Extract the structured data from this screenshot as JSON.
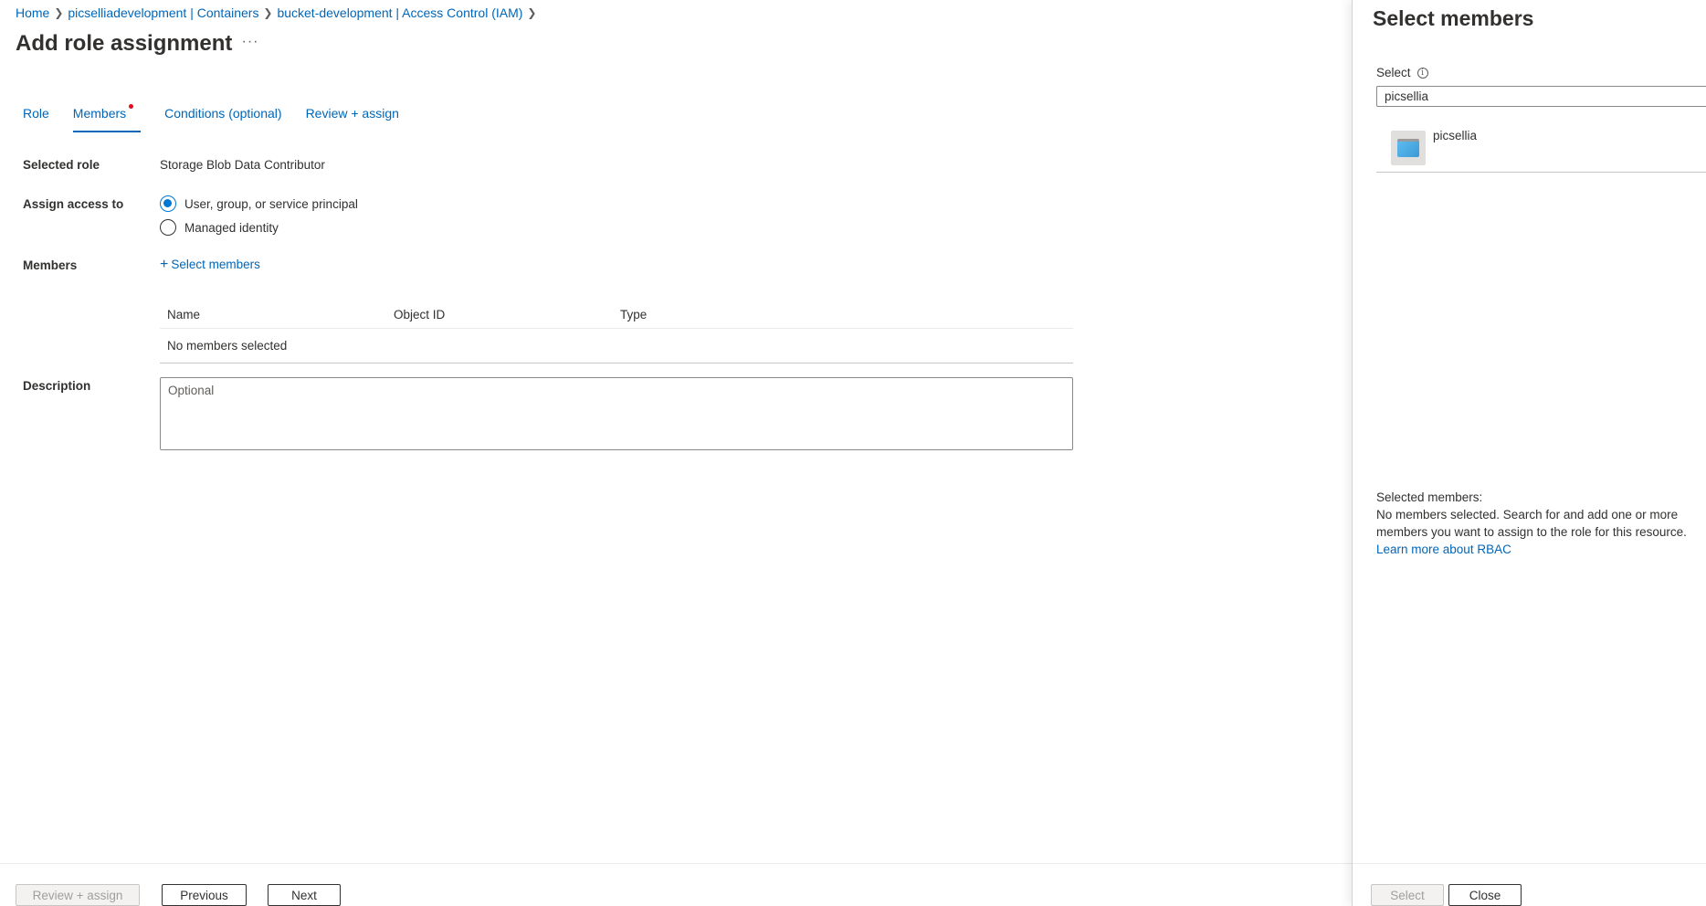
{
  "breadcrumb": {
    "items": [
      "Home",
      "picselliadevelopment | Containers",
      "bucket-development | Access Control (IAM)"
    ]
  },
  "page": {
    "title": "Add role assignment",
    "more": "···"
  },
  "tabs": [
    {
      "label": "Role"
    },
    {
      "label": "Members"
    },
    {
      "label": "Conditions (optional)"
    },
    {
      "label": "Review + assign"
    }
  ],
  "form": {
    "selected_role_label": "Selected role",
    "selected_role_value": "Storage Blob Data Contributor",
    "assign_access_label": "Assign access to",
    "assign_options": [
      "User, group, or service principal",
      "Managed identity"
    ],
    "members_label": "Members",
    "select_members_link": "Select members",
    "table_headers": [
      "Name",
      "Object ID",
      "Type"
    ],
    "table_empty": "No members selected",
    "description_label": "Description",
    "description_placeholder": "Optional"
  },
  "footer": {
    "review_assign": "Review + assign",
    "previous": "Previous",
    "next": "Next"
  },
  "panel": {
    "title": "Select members",
    "select_label": "Select",
    "search_value": "picsellia",
    "results": [
      {
        "name": "picsellia"
      }
    ],
    "selected_members_title": "Selected members:",
    "selected_members_desc": "No members selected. Search for and add one or more members you want to assign to the role for this resource.",
    "learn_more": "Learn more about RBAC",
    "select_button": "Select",
    "close_button": "Close"
  },
  "colors": {
    "accent": "#0078d4",
    "link": "#0066b8",
    "required_dot": "#e00b1c"
  }
}
